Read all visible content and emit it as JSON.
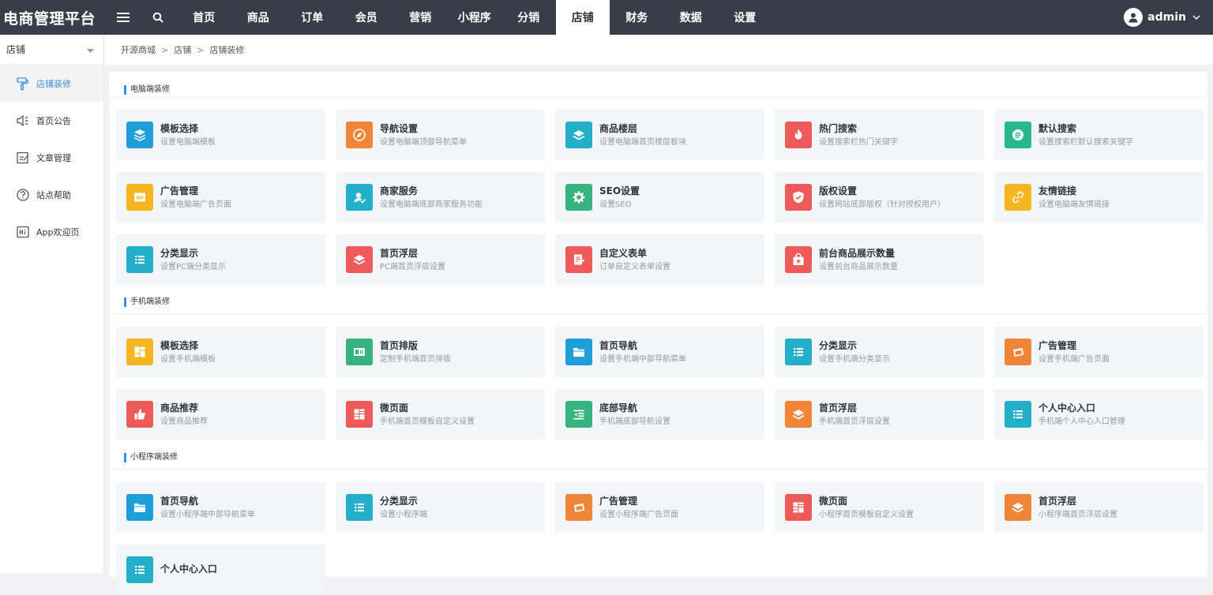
{
  "app": {
    "title": "电商管理平台",
    "user": "admin"
  },
  "nav": [
    {
      "label": "首页",
      "active": false
    },
    {
      "label": "商品",
      "active": false
    },
    {
      "label": "订单",
      "active": false
    },
    {
      "label": "会员",
      "active": false
    },
    {
      "label": "营销",
      "active": false
    },
    {
      "label": "小程序",
      "active": false
    },
    {
      "label": "分销",
      "active": false
    },
    {
      "label": "店铺",
      "active": true
    },
    {
      "label": "财务",
      "active": false
    },
    {
      "label": "数据",
      "active": false
    },
    {
      "label": "设置",
      "active": false
    }
  ],
  "sidebar": {
    "title": "店铺",
    "items": [
      {
        "label": "店铺装修",
        "icon": "paint-roller-icon",
        "active": true
      },
      {
        "label": "首页公告",
        "icon": "speaker-icon",
        "active": false
      },
      {
        "label": "文章管理",
        "icon": "edit-icon",
        "active": false
      },
      {
        "label": "站点帮助",
        "icon": "help-icon",
        "active": false
      },
      {
        "label": "App欢迎页",
        "icon": "hi-icon",
        "active": false
      }
    ]
  },
  "breadcrumb": [
    "开源商城",
    "店铺",
    "店铺装修"
  ],
  "colors": {
    "blue": "#1e9fd9",
    "orange": "#f0853a",
    "teal": "#23aec9",
    "red": "#ec5a5a",
    "green": "#28b98b",
    "yellow": "#f5b621",
    "lime": "#36b37e",
    "accent": "#3a8ee6"
  },
  "sections": [
    {
      "title": "电脑端装修",
      "cards": [
        {
          "title": "模板选择",
          "desc": "设置电脑端模板",
          "icon": "layers-icon",
          "color": "#1e9fd9"
        },
        {
          "title": "导航设置",
          "desc": "设置电脑端顶部导航菜单",
          "icon": "compass-icon",
          "color": "#f0853a"
        },
        {
          "title": "商品楼层",
          "desc": "设置电脑端首页楼层板块",
          "icon": "stack-icon",
          "color": "#23aec9"
        },
        {
          "title": "热门搜索",
          "desc": "设置搜索栏热门关键字",
          "icon": "fire-icon",
          "color": "#ec5a5a"
        },
        {
          "title": "默认搜索",
          "desc": "设置搜索栏默认搜索关键字",
          "icon": "search-list-icon",
          "color": "#28b98b"
        },
        {
          "title": "广告管理",
          "desc": "设置电脑端广告页面",
          "icon": "ad-icon",
          "color": "#f5b621"
        },
        {
          "title": "商家服务",
          "desc": "设置电脑端底部商家服务功能",
          "icon": "service-icon",
          "color": "#23aec9"
        },
        {
          "title": "SEO设置",
          "desc": "设置SEO",
          "icon": "gear-icon",
          "color": "#36b37e"
        },
        {
          "title": "版权设置",
          "desc": "设置网站底部版权（针对授权用户）",
          "icon": "shield-icon",
          "color": "#ec5a5a"
        },
        {
          "title": "友情链接",
          "desc": "设置电脑端友情链接",
          "icon": "link-icon",
          "color": "#f5b621"
        },
        {
          "title": "分类显示",
          "desc": "设置PC端分类显示",
          "icon": "list-icon",
          "color": "#23aec9"
        },
        {
          "title": "首页浮层",
          "desc": "PC端首页浮层设置",
          "icon": "stack-icon",
          "color": "#ec5a5a"
        },
        {
          "title": "自定义表单",
          "desc": "订单自定义表单设置",
          "icon": "form-icon",
          "color": "#ec5a5a"
        },
        {
          "title": "前台商品展示数量",
          "desc": "设置前台商品展示数量",
          "icon": "bag-icon",
          "color": "#ec5a5a"
        }
      ]
    },
    {
      "title": "手机端装修",
      "cards": [
        {
          "title": "模板选择",
          "desc": "设置手机端模板",
          "icon": "grid-icon",
          "color": "#f5b621"
        },
        {
          "title": "首页排版",
          "desc": "定制手机端首页排版",
          "icon": "layout-icon",
          "color": "#36b37e"
        },
        {
          "title": "首页导航",
          "desc": "设置手机端中部导航菜单",
          "icon": "folder-icon",
          "color": "#1e9fd9"
        },
        {
          "title": "分类显示",
          "desc": "设置手机端分类显示",
          "icon": "list-icon",
          "color": "#23aec9"
        },
        {
          "title": "广告管理",
          "desc": "设置手机端广告页面",
          "icon": "ad-card-icon",
          "color": "#f0853a"
        },
        {
          "title": "商品推荐",
          "desc": "设置商品推荐",
          "icon": "thumb-up-icon",
          "color": "#ec5a5a"
        },
        {
          "title": "微页面",
          "desc": "手机端首页模板自定义设置",
          "icon": "page-icon",
          "color": "#ec5a5a"
        },
        {
          "title": "底部导航",
          "desc": "手机端底部导航设置",
          "icon": "menu-icon",
          "color": "#36b37e"
        },
        {
          "title": "首页浮层",
          "desc": "手机端首页浮层设置",
          "icon": "stack-icon",
          "color": "#f0853a"
        },
        {
          "title": "个人中心入口",
          "desc": "手机端个人中心入口管理",
          "icon": "list-icon",
          "color": "#23aec9"
        }
      ]
    },
    {
      "title": "小程序端装修",
      "cards": [
        {
          "title": "首页导航",
          "desc": "设置小程序端中部导航菜单",
          "icon": "folder-icon",
          "color": "#1e9fd9"
        },
        {
          "title": "分类显示",
          "desc": "设置小程序端",
          "icon": "list-icon",
          "color": "#23aec9"
        },
        {
          "title": "广告管理",
          "desc": "设置小程序端广告页面",
          "icon": "ad-card-icon",
          "color": "#f0853a"
        },
        {
          "title": "微页面",
          "desc": "小程序首页模板自定义设置",
          "icon": "page-icon",
          "color": "#ec5a5a"
        },
        {
          "title": "首页浮层",
          "desc": "小程序端首页浮层设置",
          "icon": "stack-icon",
          "color": "#f0853a"
        },
        {
          "title": "个人中心入口",
          "desc": "",
          "icon": "list-icon",
          "color": "#23aec9"
        }
      ]
    }
  ]
}
